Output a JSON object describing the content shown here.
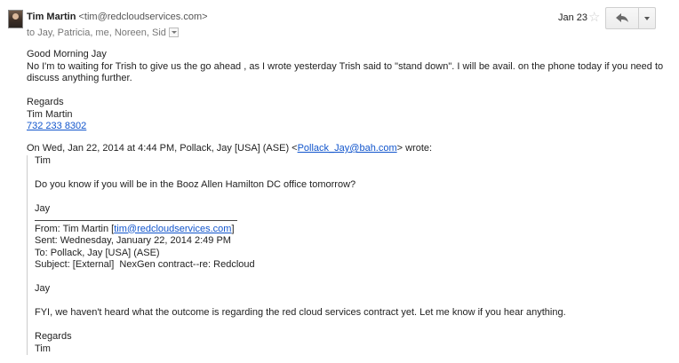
{
  "header": {
    "sender_name": "Tim Martin",
    "sender_email": "<tim@redcloudservices.com>",
    "recipients": "to Jay, Patricia, me, Noreen, Sid",
    "date": "Jan 23",
    "star": "☆"
  },
  "message": {
    "greeting": "Good Morning Jay",
    "line1": "No I'm to waiting for Trish to give us the go ahead , as I wrote yesterday Trish said to \"stand down\". I will be avail. on the phone today if you need to",
    "line2": "discuss anything further.",
    "regards": "Regards",
    "signature_name": "Tim Martin",
    "signature_phone": "732 233 8302"
  },
  "quote": {
    "header_prefix": "On Wed, Jan 22, 2014 at 4:44 PM, Pollack, Jay [USA] (ASE) <",
    "header_email": "Pollack_Jay@bah.com",
    "header_suffix": "> wrote:",
    "salutation": "Tim",
    "question": "Do you know if you will be in the Booz Allen Hamilton DC office tomorrow?",
    "signoff": "Jay",
    "from_prefix": "From: Tim Martin [",
    "from_email": "tim@redcloudservices.com",
    "from_suffix": "]",
    "sent": "Sent: Wednesday, January 22, 2014 2:49 PM",
    "to": "To: Pollack, Jay [USA] (ASE)",
    "subject": "Subject: [External]  NexGen contract--re: Redcloud",
    "inner_salutation": "Jay",
    "inner_body": "FYI, we haven't heard what the outcome is regarding the red cloud services contract yet. Let me know if you hear anything.",
    "inner_regards": "Regards",
    "inner_signoff": "Tim"
  },
  "icons": {
    "avatar": "avatar-photo",
    "star": "star-icon",
    "reply": "reply-arrow-icon",
    "more": "chevron-down-icon"
  }
}
